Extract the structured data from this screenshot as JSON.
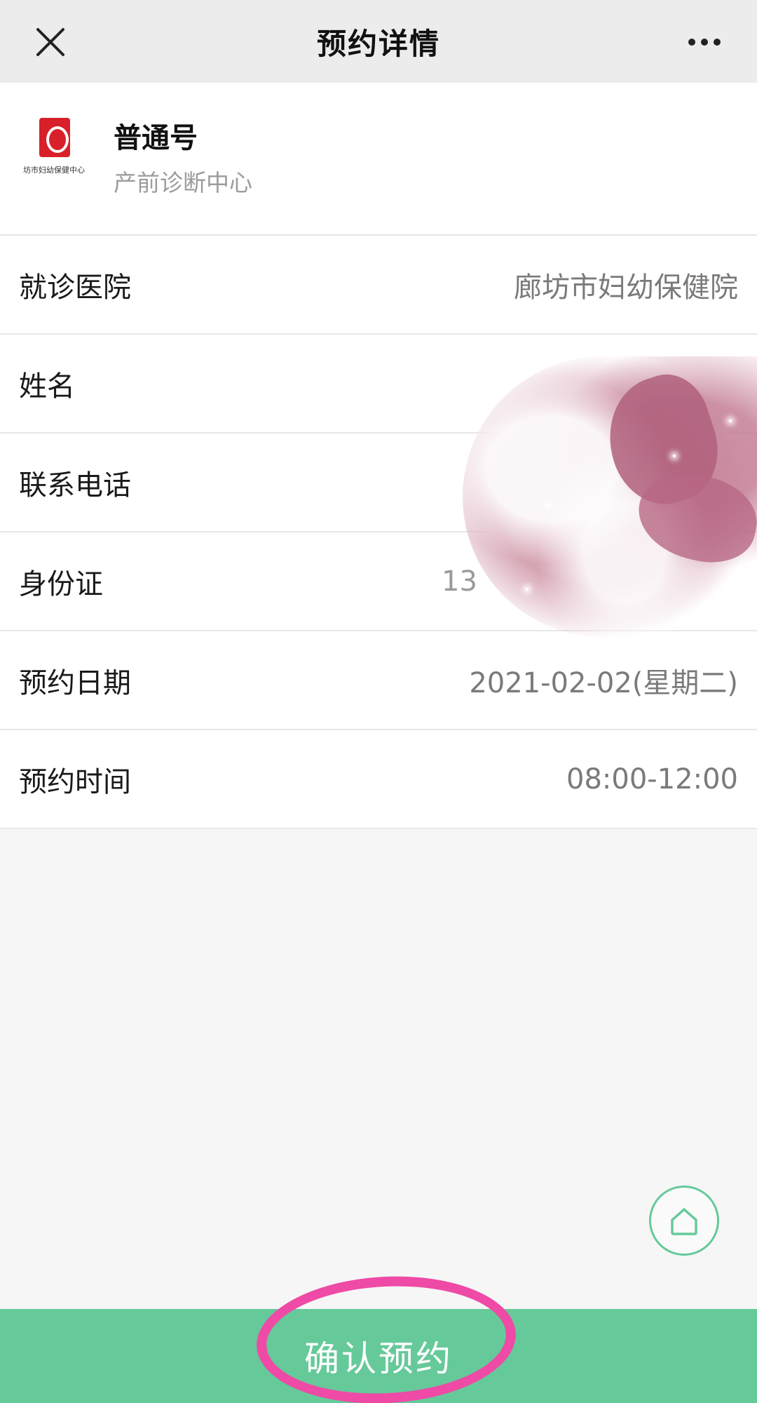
{
  "topbar": {
    "title": "预约详情"
  },
  "header": {
    "logo_text": "坊市妇幼保健中心",
    "registration_type": "普通号",
    "department": "产前诊断中心"
  },
  "rows": [
    {
      "label": "就诊医院",
      "value": "廊坊市妇幼保健院"
    },
    {
      "label": "姓名",
      "value": ""
    },
    {
      "label": "联系电话",
      "value": ""
    },
    {
      "label": "身份证",
      "value": "13"
    },
    {
      "label": "预约日期",
      "value": "2021-02-02(星期二)"
    },
    {
      "label": "预约时间",
      "value": "08:00-12:00"
    }
  ],
  "confirm_button": {
    "label": "确认预约"
  },
  "colors": {
    "accent_green": "#66c99a",
    "highlight_pink": "#ee4aa6",
    "logo_red": "#d8202a"
  },
  "icons": {
    "close": "close-icon",
    "more": "more-icon",
    "home": "home-icon"
  }
}
